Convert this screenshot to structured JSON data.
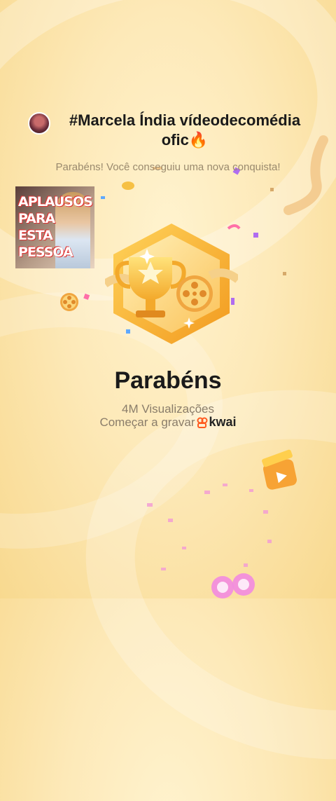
{
  "header": {
    "title": "#Marcela Índia vídeodecomédia ofic🔥"
  },
  "subtitle": "Parabéns! Você conseguiu uma nova conquista!",
  "sticker": {
    "text": "APLAUSOS PARA ESTA PESSOA"
  },
  "main": {
    "congrats_label": "Parabéns",
    "views_label": "4M Visualizações",
    "start_label": "Começar a gravar",
    "brand_label": "kwai"
  },
  "colors": {
    "background": "#fde9b8",
    "badge_gold": "#f6b93b",
    "brand_orange": "#ff5a1f"
  },
  "icons": [
    "avatar",
    "trophy-badge-icon",
    "film-reel-icon",
    "clapperboard-icon",
    "kwai-logo-icon"
  ]
}
